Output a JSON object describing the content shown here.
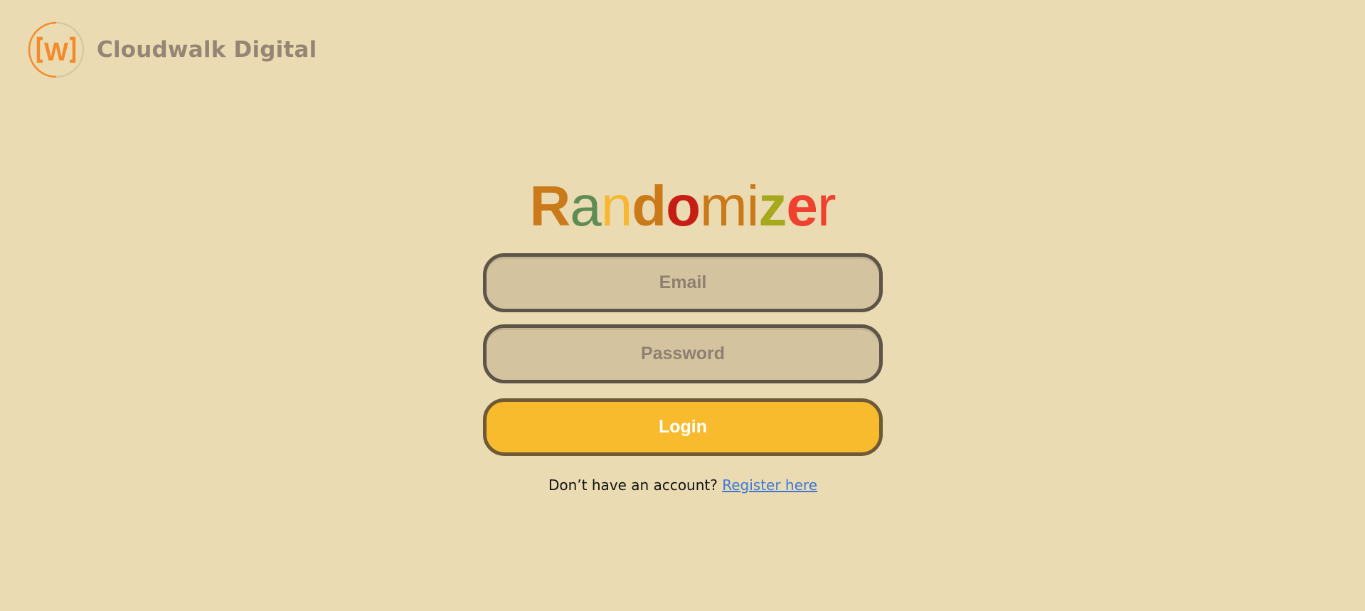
{
  "brand": {
    "logo_icon": "cloudwalk-w-logo-icon",
    "logo_text": "W",
    "name": "Cloudwalk Digital",
    "accent_color": "#F58A2A",
    "name_color": "#958574"
  },
  "title": {
    "letters": [
      {
        "char": "R",
        "color": "#CB7A1A",
        "weight": "bold"
      },
      {
        "char": "a",
        "color": "#5E8C54",
        "weight": "normal"
      },
      {
        "char": "n",
        "color": "#F6B832",
        "weight": "normal"
      },
      {
        "char": "d",
        "color": "#CB7A1A",
        "weight": "bold"
      },
      {
        "char": "o",
        "color": "#C61E14",
        "weight": "bold"
      },
      {
        "char": "m",
        "color": "#CB7A1A",
        "weight": "normal"
      },
      {
        "char": "i",
        "color": "#CB7A1A",
        "weight": "normal"
      },
      {
        "char": "z",
        "color": "#A6A81E",
        "weight": "bold"
      },
      {
        "char": "e",
        "color": "#F0402E",
        "weight": "bold"
      },
      {
        "char": "r",
        "color": "#F0402E",
        "weight": "normal"
      }
    ]
  },
  "form": {
    "email": {
      "value": "",
      "placeholder": "Email"
    },
    "password": {
      "value": "",
      "placeholder": "Password"
    },
    "login_label": "Login",
    "register_prompt": "Don’t have an account?",
    "register_link": "Register here"
  },
  "colors": {
    "background": "#EADBB2",
    "field_fill": "#D4C39F",
    "field_border": "#5E5447",
    "button_fill": "#F8BB2E",
    "link": "#3E78D6"
  }
}
